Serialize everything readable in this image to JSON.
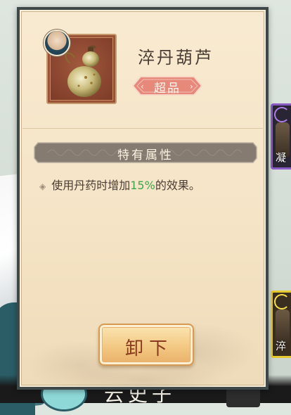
{
  "item": {
    "name": "淬丹葫芦",
    "rarity": "超品",
    "icon": "gourd-icon"
  },
  "section": {
    "title": "特有属性"
  },
  "attribute": {
    "prefix": "使用丹药时增加",
    "value": "15%",
    "suffix": "的效果。"
  },
  "actions": {
    "unequip_label": "卸下"
  },
  "background": {
    "side_card_top_glyph": "凝",
    "side_card_bottom_glyph": "淬",
    "bottom_name": "云史子"
  },
  "colors": {
    "highlight": "#3aa84a",
    "rarity_badge": "#e6897b",
    "panel_border": "#3f4848"
  }
}
